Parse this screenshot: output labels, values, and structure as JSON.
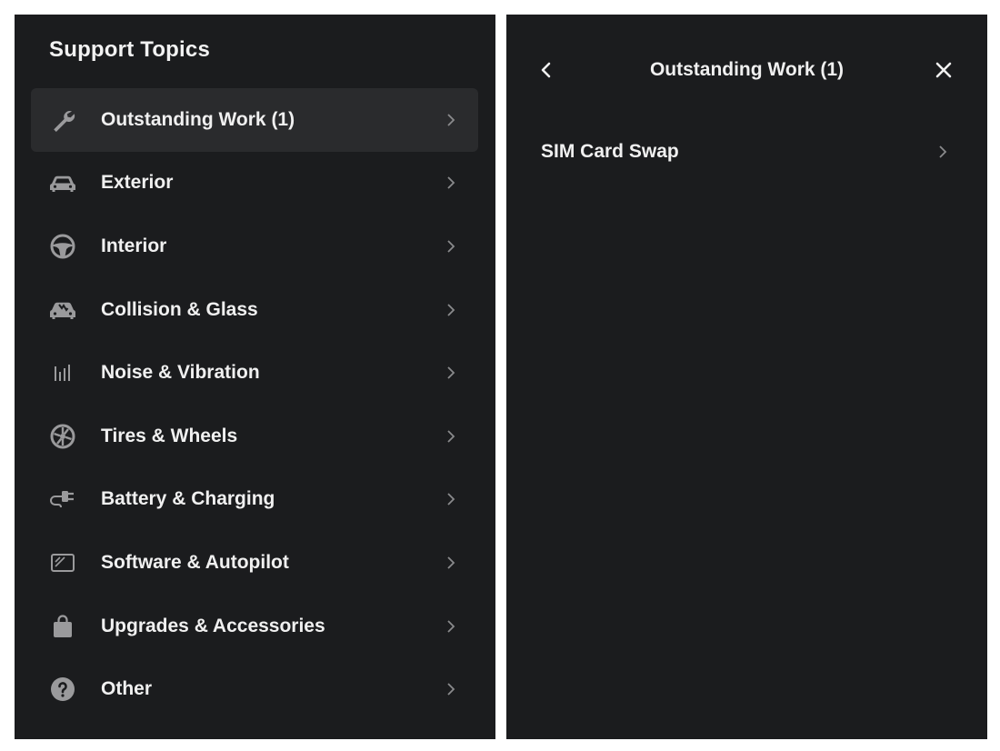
{
  "left_panel": {
    "title": "Support Topics",
    "topics": [
      {
        "label": "Outstanding Work (1)",
        "icon": "wrench-icon",
        "active": true
      },
      {
        "label": "Exterior",
        "icon": "car-icon"
      },
      {
        "label": "Interior",
        "icon": "steering-wheel-icon"
      },
      {
        "label": "Collision & Glass",
        "icon": "collision-car-icon"
      },
      {
        "label": "Noise & Vibration",
        "icon": "sound-bars-icon"
      },
      {
        "label": "Tires & Wheels",
        "icon": "wheel-icon"
      },
      {
        "label": "Battery & Charging",
        "icon": "charging-plug-icon"
      },
      {
        "label": "Software & Autopilot",
        "icon": "screen-icon"
      },
      {
        "label": "Upgrades & Accessories",
        "icon": "shopping-bag-icon"
      },
      {
        "label": "Other",
        "icon": "question-circle-icon"
      }
    ]
  },
  "right_panel": {
    "title": "Outstanding Work (1)",
    "back_icon": "chevron-left-icon",
    "close_icon": "close-icon",
    "items": [
      {
        "label": "SIM Card Swap"
      }
    ]
  },
  "colors": {
    "panel_bg": "#1b1c1e",
    "active_row_bg": "#2a2b2d",
    "text": "#f0f0f0",
    "icon": "#9a9a9c",
    "chevron": "#8a8a8c",
    "page_bg": "#ffffff"
  }
}
